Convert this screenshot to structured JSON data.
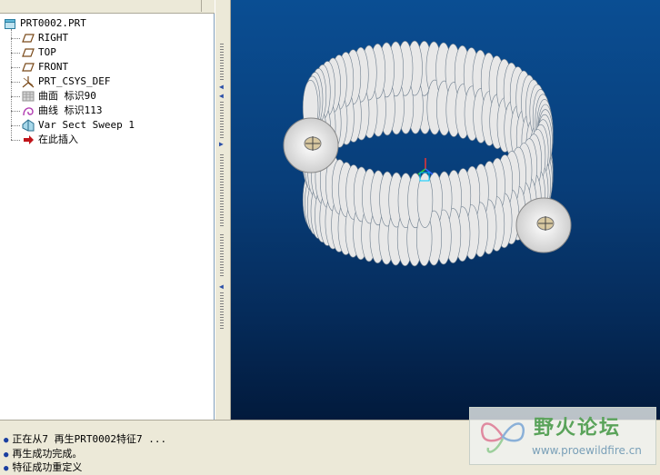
{
  "model_tree": {
    "items": [
      {
        "label": "PRT0002.PRT",
        "icon": "part-icon"
      },
      {
        "label": "RIGHT",
        "icon": "datum-plane-icon"
      },
      {
        "label": "TOP",
        "icon": "datum-plane-icon"
      },
      {
        "label": "FRONT",
        "icon": "datum-plane-icon"
      },
      {
        "label": "PRT_CSYS_DEF",
        "icon": "csys-icon"
      },
      {
        "label": "曲面 标识90",
        "icon": "surface-icon"
      },
      {
        "label": "曲线 标识113",
        "icon": "curve-icon"
      },
      {
        "label": "Var Sect Sweep 1",
        "icon": "sweep-icon"
      },
      {
        "label": "在此插入",
        "icon": "insert-here-arrow-icon"
      }
    ]
  },
  "messages": [
    "正在从7 再生PRT0002特征7 ...",
    "再生成功完成。",
    "特征成功重定义"
  ],
  "watermark": {
    "name": "野火论坛",
    "url": "www.proewildfire.cn"
  },
  "colors": {
    "viewport_top": "#0a4e93",
    "viewport_bottom": "#021a3c",
    "coil": "#e8e8e8"
  }
}
